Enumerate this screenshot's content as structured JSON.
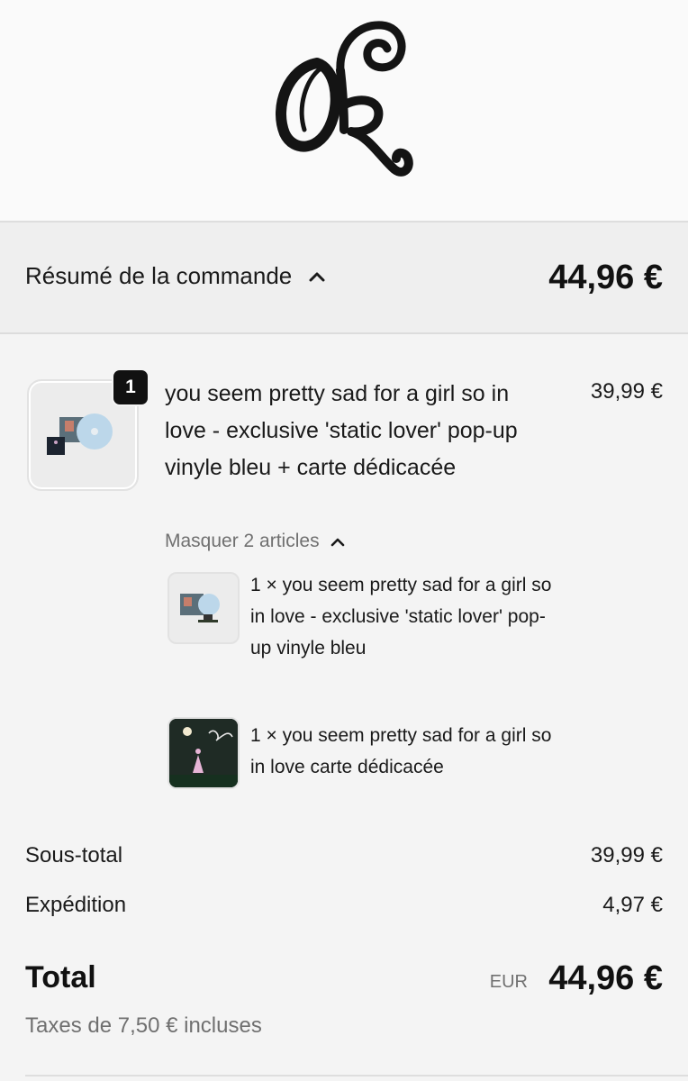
{
  "brand": {
    "logo_text": "OR"
  },
  "summary": {
    "toggle_label": "Résumé de la commande",
    "toggle_icon": "chevron-up-icon",
    "total": "44,96 €"
  },
  "product": {
    "quantity_badge": "1",
    "title": "you seem pretty sad for a girl so in love - exclusive 'static lover' pop-up vinyle bleu + carte dédicacée",
    "price": "39,99 €",
    "hide_items_label": "Masquer 2 articles",
    "hide_items_icon": "chevron-up-icon",
    "bundle_items": [
      {
        "label": "1 × you seem pretty sad for a girl so in love - exclusive 'static lover' pop-up vinyle bleu"
      },
      {
        "label": "1 × you seem pretty sad for a girl so in love carte dédicacée"
      }
    ]
  },
  "totals": {
    "subtotal_label": "Sous-total",
    "subtotal_value": "39,99 €",
    "shipping_label": "Expédition",
    "shipping_value": "4,97 €",
    "total_label": "Total",
    "total_currency": "EUR",
    "total_value": "44,96 €",
    "taxes_note": "Taxes de 7,50 € incluses"
  }
}
